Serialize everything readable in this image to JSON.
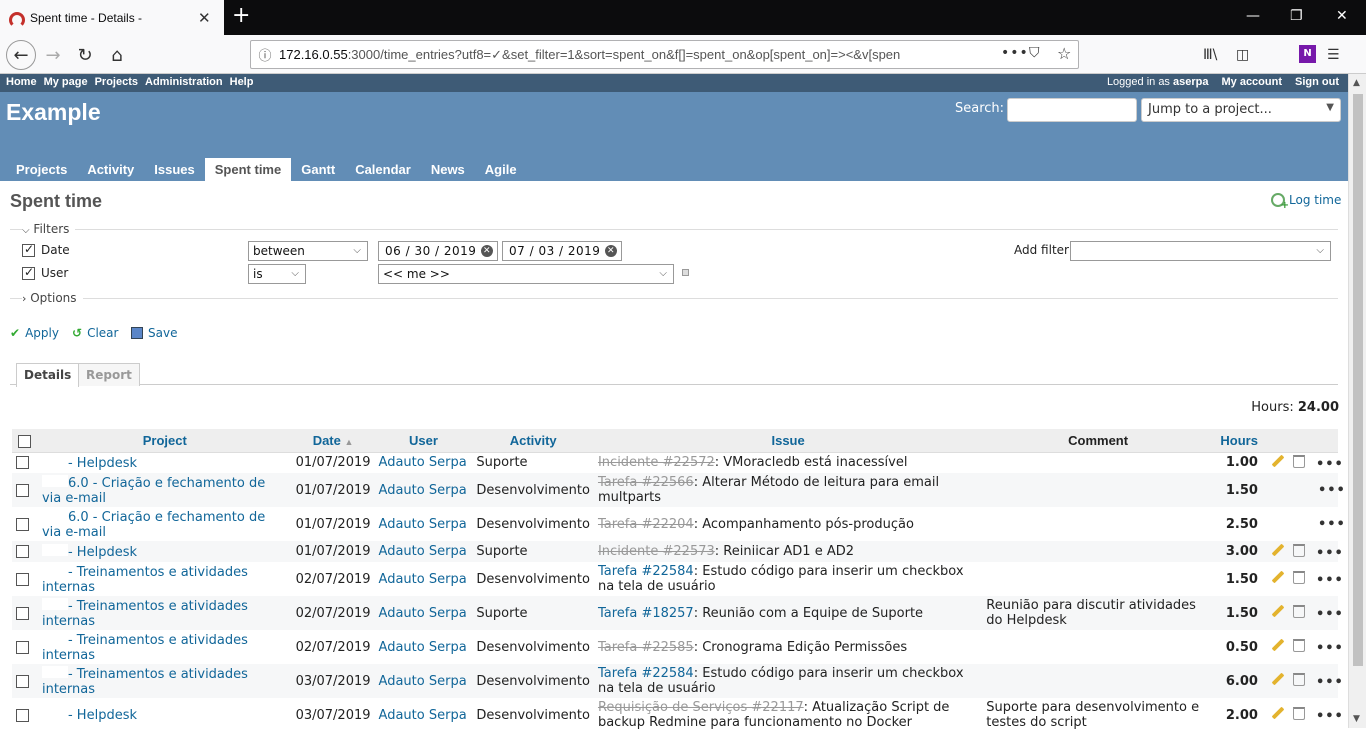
{
  "browser": {
    "tab_title": "Spent time - Details - ",
    "url_host": "172.16.0.55",
    "url_rest": ":3000/time_entries?utf8=✓&set_filter=1&sort=spent_on&f[]=spent_on&op[spent_on]=><&v[spen",
    "onenote_label": "N"
  },
  "top_menu": {
    "left": [
      "Home",
      "My page",
      "Projects",
      "Administration",
      "Help"
    ],
    "logged_prefix": "Logged in as",
    "user": "aserpa",
    "my_account": "My account",
    "sign_out": "Sign out"
  },
  "header": {
    "title": "Example",
    "search_label": "Search:",
    "jump_label": "Jump to a project..."
  },
  "main_menu": {
    "tabs": [
      "Projects",
      "Activity",
      "Issues",
      "Spent time",
      "Gantt",
      "Calendar",
      "News",
      "Agile"
    ]
  },
  "page": {
    "title": "Spent time",
    "log_time": "Log time"
  },
  "filters": {
    "legend": "Filters",
    "date_label": "Date",
    "date_operator": "between",
    "date_from": "06 / 30 / 2019",
    "date_to": "07 / 03 / 2019",
    "user_label": "User",
    "user_operator": "is",
    "user_value": "<< me >>",
    "add_filter_label": "Add filter",
    "options_legend": "Options"
  },
  "actions": {
    "apply": "Apply",
    "clear": "Clear",
    "save": "Save"
  },
  "tabs": {
    "details": "Details",
    "report": "Report"
  },
  "total": {
    "label": "Hours:",
    "value": "24.00"
  },
  "table": {
    "headers": {
      "project": "Project",
      "date": "Date",
      "date_sort_icon": "▲",
      "user": "User",
      "activity": "Activity",
      "issue": "Issue",
      "comment": "Comment",
      "hours": "Hours"
    },
    "rows": [
      {
        "project": "- Helpdesk",
        "date": "01/07/2019",
        "user": "Adauto Serpa",
        "activity": "Suporte",
        "issue_ref": "Incidente #22572",
        "issue_text": ": VMoracledb está inacessível",
        "comment": "",
        "hours": "1.00"
      },
      {
        "project": "6.0 - Criação e fechamento de via e-mail",
        "date": "01/07/2019",
        "user": "Adauto Serpa",
        "activity": "Desenvolvimento",
        "issue_ref": "Tarefa #22566",
        "issue_text": ": Alterar Método de leitura para email multparts",
        "comment": "",
        "hours": "1.50"
      },
      {
        "project": "6.0 - Criação e fechamento de via e-mail",
        "date": "01/07/2019",
        "user": "Adauto Serpa",
        "activity": "Desenvolvimento",
        "issue_ref": "Tarefa #22204",
        "issue_text": ": Acompanhamento pós-produção",
        "comment": "",
        "hours": "2.50"
      },
      {
        "project": "- Helpdesk",
        "date": "01/07/2019",
        "user": "Adauto Serpa",
        "activity": "Suporte",
        "issue_ref": "Incidente #22573",
        "issue_text": ": Reiniicar AD1 e AD2",
        "comment": "",
        "hours": "3.00"
      },
      {
        "project": "- Treinamentos e atividades internas",
        "date": "02/07/2019",
        "user": "Adauto Serpa",
        "activity": "Desenvolvimento",
        "issue_ref": "Tarefa #22584",
        "issue_text": ": Estudo código para inserir um checkbox na tela de usuário",
        "comment": "",
        "hours": "1.50"
      },
      {
        "project": "- Treinamentos e atividades internas",
        "date": "02/07/2019",
        "user": "Adauto Serpa",
        "activity": "Suporte",
        "issue_ref": "Tarefa #18257",
        "issue_text": ": Reunião com a Equipe de Suporte",
        "comment": "Reunião para discutir atividades do Helpdesk",
        "hours": "1.50"
      },
      {
        "project": "- Treinamentos e atividades internas",
        "date": "02/07/2019",
        "user": "Adauto Serpa",
        "activity": "Desenvolvimento",
        "issue_ref": "Tarefa #22585",
        "issue_text": ": Cronograma Edição Permissões",
        "comment": "",
        "hours": "0.50"
      },
      {
        "project": "- Treinamentos e atividades internas",
        "date": "03/07/2019",
        "user": "Adauto Serpa",
        "activity": "Desenvolvimento",
        "issue_ref": "Tarefa #22584",
        "issue_text": ": Estudo código para inserir um checkbox na tela de usuário",
        "comment": "",
        "hours": "6.00"
      },
      {
        "project": "- Helpdesk",
        "date": "03/07/2019",
        "user": "Adauto Serpa",
        "activity": "Desenvolvimento",
        "issue_ref": "Requisição de Serviços #22117",
        "issue_text": ": Atualização Script de backup Redmine para funcionamento no Docker",
        "comment": "Suporte para desenvolvimento e testes do script",
        "hours": "2.00"
      }
    ]
  }
}
